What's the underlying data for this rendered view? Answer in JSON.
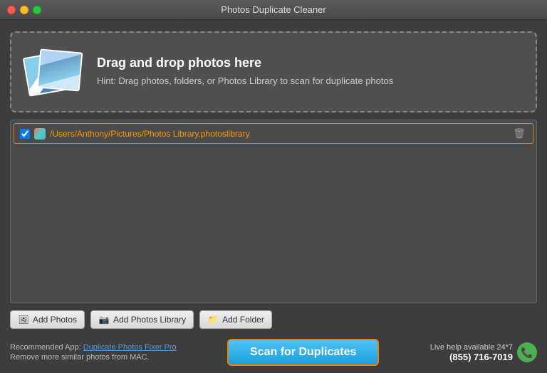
{
  "titleBar": {
    "title": "Photos Duplicate Cleaner"
  },
  "dropZone": {
    "heading": "Drag and drop photos here",
    "hint": "Hint: Drag photos, folders, or Photos Library to scan for duplicate photos"
  },
  "fileList": {
    "items": [
      {
        "path": "/Users/Anthony/Pictures/Photos Library.photoslibrary",
        "checked": true
      }
    ]
  },
  "toolbar": {
    "addPhotosLabel": "Add Photos",
    "addPhotosLibraryLabel": "Add Photos Library",
    "addFolderLabel": "Add Folder"
  },
  "bottomBar": {
    "recommendedLabel": "Recommended App:",
    "appName": "Duplicate Photos Fixer Pro",
    "removeText": "Remove more similar photos from MAC.",
    "scanButtonLabel": "Scan for Duplicates",
    "supportText": "Live help available 24*7",
    "phoneNumber": "(855) 716-7019"
  }
}
